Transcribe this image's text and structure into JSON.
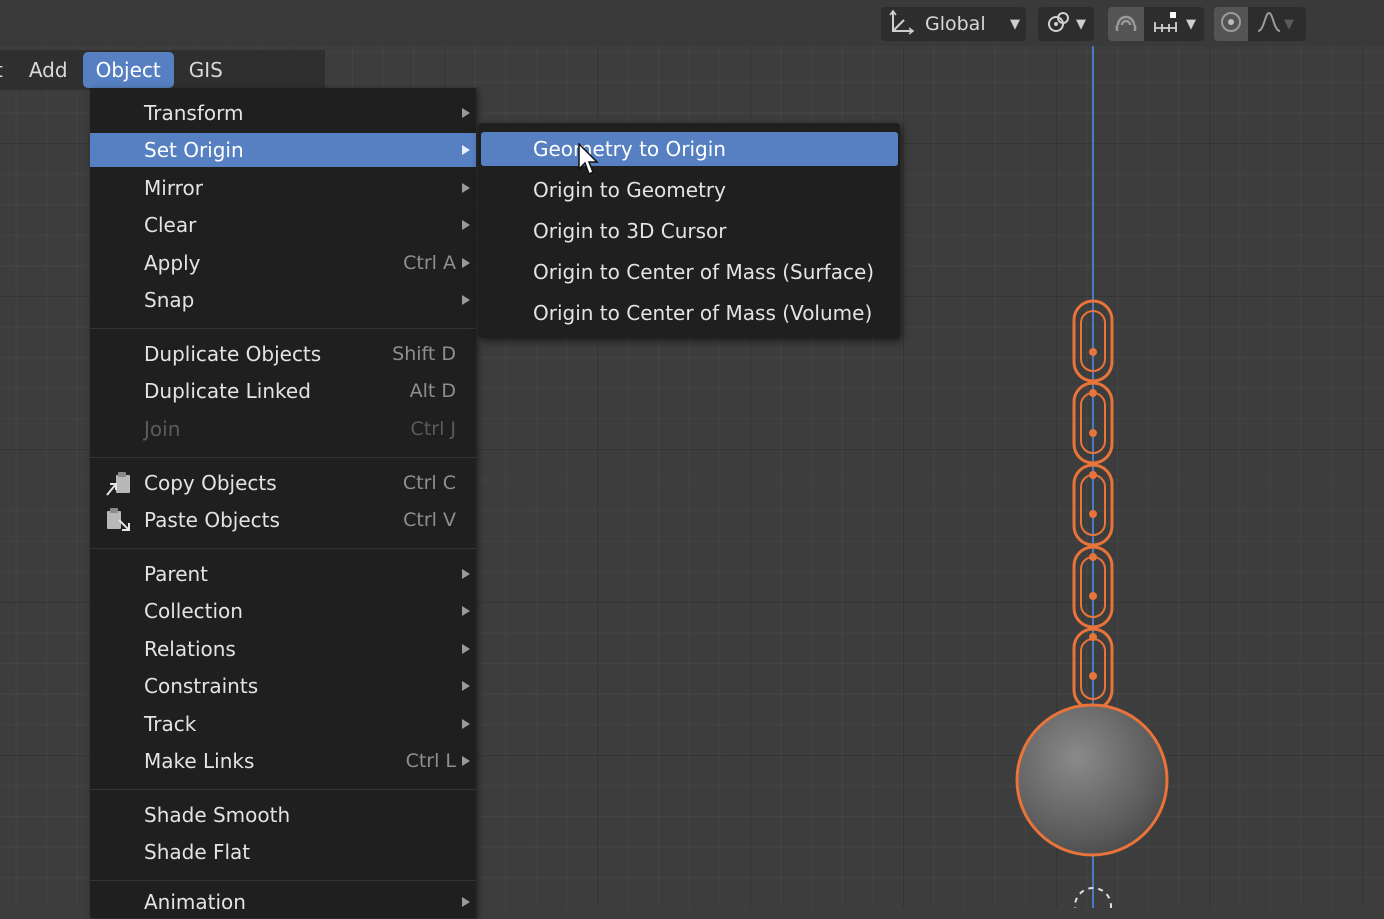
{
  "header": {
    "orientation_label": "Global",
    "icons": [
      "transform-orientation-icon",
      "pivot-point-icon",
      "snap-magnet-icon",
      "snap-increment-icon",
      "proportional-edit-icon",
      "falloff-curve-icon"
    ]
  },
  "menubar": {
    "items": [
      "t",
      "Add",
      "Object",
      "GIS"
    ],
    "active": "Object"
  },
  "object_menu": {
    "transform": "Transform",
    "set_origin": "Set Origin",
    "mirror": "Mirror",
    "clear": "Clear",
    "apply": "Apply",
    "apply_shortcut": "Ctrl A",
    "snap": "Snap",
    "duplicate_objects": "Duplicate Objects",
    "duplicate_objects_shortcut": "Shift D",
    "duplicate_linked": "Duplicate Linked",
    "duplicate_linked_shortcut": "Alt D",
    "join": "Join",
    "join_shortcut": "Ctrl J",
    "copy_objects": "Copy Objects",
    "copy_objects_shortcut": "Ctrl C",
    "paste_objects": "Paste Objects",
    "paste_objects_shortcut": "Ctrl V",
    "parent": "Parent",
    "collection": "Collection",
    "relations": "Relations",
    "constraints": "Constraints",
    "track": "Track",
    "make_links": "Make Links",
    "make_links_shortcut": "Ctrl L",
    "shade_smooth": "Shade Smooth",
    "shade_flat": "Shade Flat",
    "animation": "Animation"
  },
  "set_origin_submenu": {
    "geometry_to_origin": "Geometry to Origin",
    "origin_to_geometry": "Origin to Geometry",
    "origin_to_3d_cursor": "Origin to 3D Cursor",
    "origin_to_com_surface": "Origin to Center of Mass (Surface)",
    "origin_to_com_volume": "Origin to Center of Mass (Volume)",
    "highlighted": "Geometry to Origin"
  },
  "colors": {
    "highlight": "#5680c2",
    "selection_outline": "#e8743a",
    "axis": "#4a7ac0",
    "menu_bg": "#1f1f1f"
  }
}
